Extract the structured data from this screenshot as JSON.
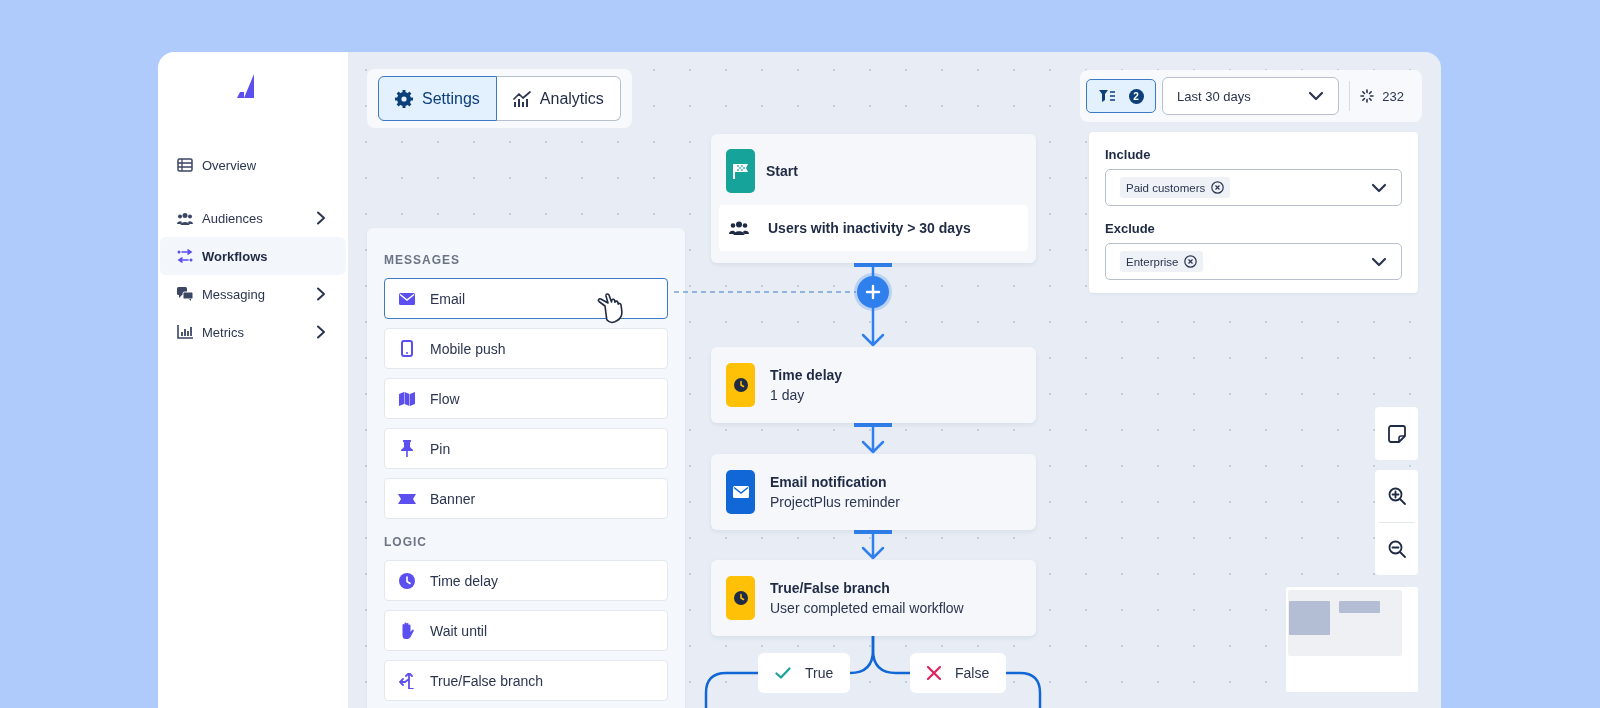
{
  "sidebar": {
    "items": [
      {
        "label": "Overview",
        "selected": false,
        "has_submenu": false
      },
      {
        "label": "Audiences",
        "selected": false,
        "has_submenu": true
      },
      {
        "label": "Workflows",
        "selected": true,
        "has_submenu": false
      },
      {
        "label": "Messaging",
        "selected": false,
        "has_submenu": true
      },
      {
        "label": "Metrics",
        "selected": false,
        "has_submenu": true
      }
    ]
  },
  "view_tabs": [
    {
      "label": "Settings",
      "selected": true
    },
    {
      "label": "Analytics",
      "selected": false
    }
  ],
  "palette": {
    "sections": [
      {
        "heading": "MESSAGES",
        "items": [
          {
            "label": "Email",
            "highlighted": true
          },
          {
            "label": "Mobile push",
            "highlighted": false
          },
          {
            "label": "Flow",
            "highlighted": false
          },
          {
            "label": "Pin",
            "highlighted": false
          },
          {
            "label": "Banner",
            "highlighted": false
          }
        ]
      },
      {
        "heading": "LOGIC",
        "items": [
          {
            "label": "Time delay",
            "highlighted": false
          },
          {
            "label": "Wait until",
            "highlighted": false
          },
          {
            "label": "True/False branch",
            "highlighted": false
          }
        ]
      }
    ]
  },
  "flow": {
    "nodes": [
      {
        "kind": "trigger",
        "title": "Start",
        "audience": "Users with inactivity > 30 days",
        "color": "#16a39a"
      },
      {
        "kind": "delay",
        "title": "Time delay",
        "subtitle": "1 day",
        "color": "#ffc107"
      },
      {
        "kind": "email",
        "title": "Email notification",
        "subtitle": "ProjectPlus reminder",
        "color": "#1267d6"
      },
      {
        "kind": "branch",
        "title": "True/False branch",
        "subtitle": "User completed email workflow",
        "color": "#ffc107"
      }
    ],
    "branches": [
      {
        "kind": "true",
        "label": "True"
      },
      {
        "kind": "false",
        "label": "False"
      }
    ]
  },
  "toolbar": {
    "filter_count": "2",
    "date_range": "Last 30 days",
    "count": "232"
  },
  "filters": [
    {
      "label": "Include",
      "tags": [
        "Paid customers"
      ]
    },
    {
      "label": "Exclude",
      "tags": [
        "Enterprise"
      ]
    }
  ]
}
